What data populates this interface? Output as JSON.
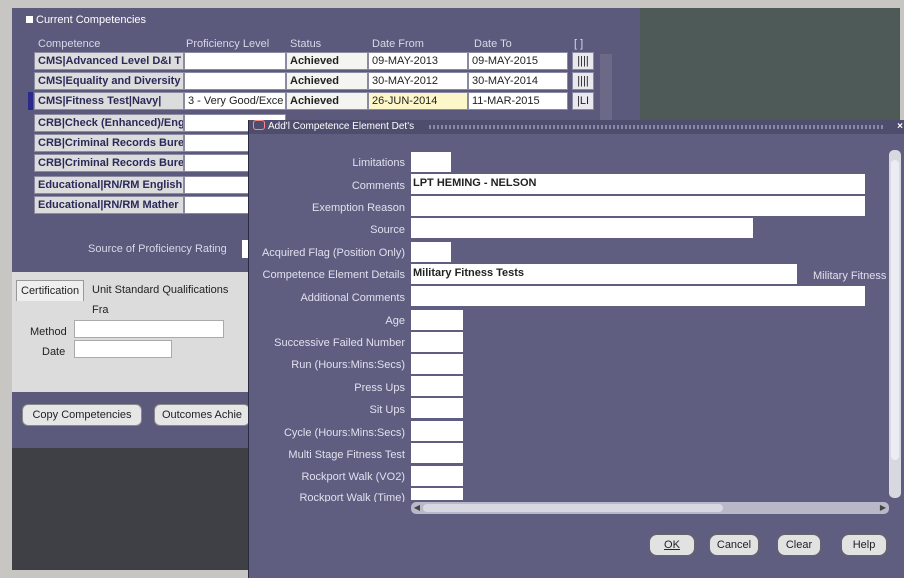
{
  "section": {
    "title": "Current Competencies"
  },
  "columns": [
    "Competence",
    "Proficiency Level",
    "Status",
    "Date From",
    "Date To",
    "[ ]"
  ],
  "rows": [
    {
      "competence": "CMS|Advanced Level D&I T",
      "proficiency": "",
      "status": "Achieved",
      "date_from": "09-MAY-2013",
      "date_to": "09-MAY-2015",
      "flag": "||||"
    },
    {
      "competence": "CMS|Equality and Diversity",
      "proficiency": "",
      "status": "Achieved",
      "date_from": "30-MAY-2012",
      "date_to": "30-MAY-2014",
      "flag": "||||"
    },
    {
      "competence": "CMS|Fitness Test|Navy|",
      "proficiency": "3 - Very Good/Exce",
      "status": "Achieved",
      "date_from": "26-JUN-2014",
      "date_to": "11-MAR-2015",
      "flag": "|LI"
    },
    {
      "competence": "CRB|Check (Enhanced)/Eng",
      "proficiency": "",
      "status": "",
      "date_from": "",
      "date_to": "",
      "flag": ""
    },
    {
      "competence": "CRB|Criminal Records Bure",
      "proficiency": "",
      "status": "",
      "date_from": "",
      "date_to": "",
      "flag": ""
    },
    {
      "competence": "CRB|Criminal Records Bure",
      "proficiency": "",
      "status": "",
      "date_from": "",
      "date_to": "",
      "flag": ""
    },
    {
      "competence": "Educational|RN/RM English",
      "proficiency": "",
      "status": "",
      "date_from": "",
      "date_to": "",
      "flag": ""
    },
    {
      "competence": "Educational|RN/RM Mather",
      "proficiency": "",
      "status": "",
      "date_from": "",
      "date_to": "",
      "flag": ""
    }
  ],
  "source_label": "Source of Proficiency Rating",
  "tabs": [
    "Certification",
    "Unit Standard Qualifications Fra"
  ],
  "form": {
    "method_label": "Method",
    "date_label": "Date"
  },
  "buttons": {
    "copy": "Copy Competencies",
    "outcomes": "Outcomes Achie"
  },
  "dialog": {
    "title": "Add'l Competence Element Det's",
    "fields": [
      {
        "label": "Limitations",
        "value": ""
      },
      {
        "label": "Comments",
        "value": "LPT HEMING - NELSON"
      },
      {
        "label": "Exemption Reason",
        "value": ""
      },
      {
        "label": "Source",
        "value": ""
      },
      {
        "label": "Acquired Flag (Position Only)",
        "value": ""
      },
      {
        "label": "Competence Element Details",
        "value": "Military Fitness Tests"
      },
      {
        "label": "Additional Comments",
        "value": ""
      },
      {
        "label": "Age",
        "value": ""
      },
      {
        "label": "Successive Failed Number",
        "value": ""
      },
      {
        "label": "Run (Hours:Mins:Secs)",
        "value": ""
      },
      {
        "label": "Press Ups",
        "value": ""
      },
      {
        "label": "Sit Ups",
        "value": ""
      },
      {
        "label": "Cycle (Hours:Mins:Secs)",
        "value": ""
      },
      {
        "label": "Multi Stage Fitness Test",
        "value": ""
      },
      {
        "label": "Rockport Walk (VO2)",
        "value": ""
      },
      {
        "label": "Rockport Walk (Time)",
        "value": ""
      }
    ],
    "right_label": "Military Fitness",
    "buttons": {
      "ok": "OK",
      "cancel": "Cancel",
      "clear": "Clear",
      "help": "Help"
    }
  }
}
